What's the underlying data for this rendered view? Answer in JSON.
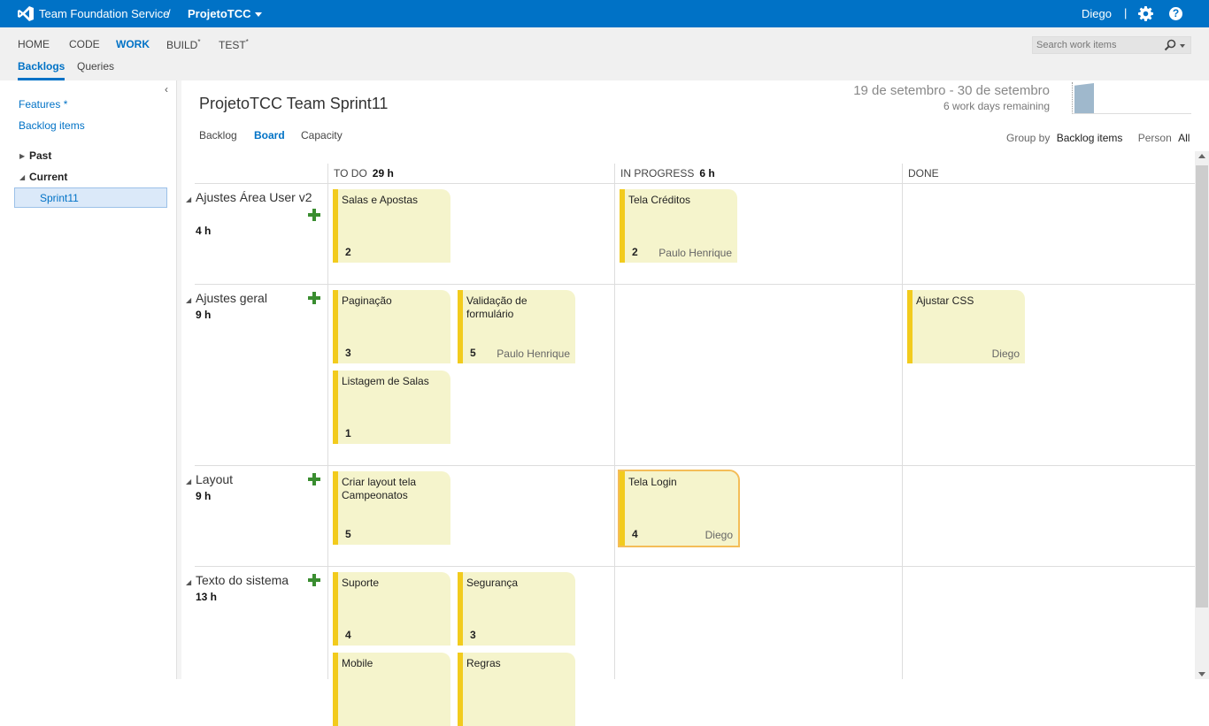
{
  "header": {
    "product": "Team Foundation Service",
    "separator": "/",
    "project": "ProjetoTCC",
    "user": "Diego",
    "pipe": "|",
    "help": "?"
  },
  "nav": {
    "tabs": [
      {
        "label": "HOME"
      },
      {
        "label": "CODE"
      },
      {
        "label": "WORK"
      },
      {
        "label": "BUILD",
        "sup": "*"
      },
      {
        "label": "TEST",
        "sup": "*"
      }
    ],
    "subtabs": [
      {
        "label": "Backlogs"
      },
      {
        "label": "Queries"
      }
    ],
    "search_placeholder": "Search work items"
  },
  "left": {
    "links": [
      "Features *",
      "Backlog items"
    ],
    "tree": {
      "past": "Past",
      "current": "Current",
      "selected": "Sprint11"
    }
  },
  "main": {
    "title": "ProjetoTCC Team Sprint11",
    "date_range": "19 de setembro - 30 de setembro",
    "remaining": "6 work days remaining",
    "view_tabs": [
      {
        "label": "Backlog"
      },
      {
        "label": "Board"
      },
      {
        "label": "Capacity"
      }
    ],
    "group_by_label": "Group by",
    "group_by_value": "Backlog items",
    "person_label": "Person",
    "person_value": "All"
  },
  "board": {
    "columns": [
      {
        "name": "TO DO",
        "hours": "29 h"
      },
      {
        "name": "IN PROGRESS",
        "hours": "6 h"
      },
      {
        "name": "DONE",
        "hours": ""
      }
    ],
    "rows": [
      {
        "title": "Ajustes Área User v2",
        "hours": "4 h"
      },
      {
        "title": "Ajustes geral",
        "hours": "9 h"
      },
      {
        "title": "Layout",
        "hours": "9 h"
      },
      {
        "title": "Texto do sistema",
        "hours": "13 h"
      }
    ],
    "cards": [
      {
        "title": "Salas e Apostas",
        "estimate": "2",
        "assignee": ""
      },
      {
        "title": "Tela Créditos",
        "estimate": "2",
        "assignee": "Paulo Henrique"
      },
      {
        "title": "Paginação",
        "estimate": "3",
        "assignee": ""
      },
      {
        "title": "Validação de formulário",
        "estimate": "5",
        "assignee": "Paulo Henrique"
      },
      {
        "title": "Ajustar CSS",
        "estimate": "",
        "assignee": "Diego"
      },
      {
        "title": "Listagem de Salas",
        "estimate": "1",
        "assignee": ""
      },
      {
        "title": "Criar layout tela Campeonatos",
        "estimate": "5",
        "assignee": ""
      },
      {
        "title": "Tela Login",
        "estimate": "4",
        "assignee": "Diego"
      },
      {
        "title": "Suporte",
        "estimate": "4",
        "assignee": ""
      },
      {
        "title": "Segurança",
        "estimate": "3",
        "assignee": ""
      },
      {
        "title": "Mobile",
        "estimate": "",
        "assignee": ""
      },
      {
        "title": "Regras",
        "estimate": "",
        "assignee": ""
      }
    ]
  },
  "colors": {
    "brand": "#0072c6",
    "card": "#f5f4cc",
    "card_accent": "#f2cb1d",
    "add": "#3a8d30"
  }
}
